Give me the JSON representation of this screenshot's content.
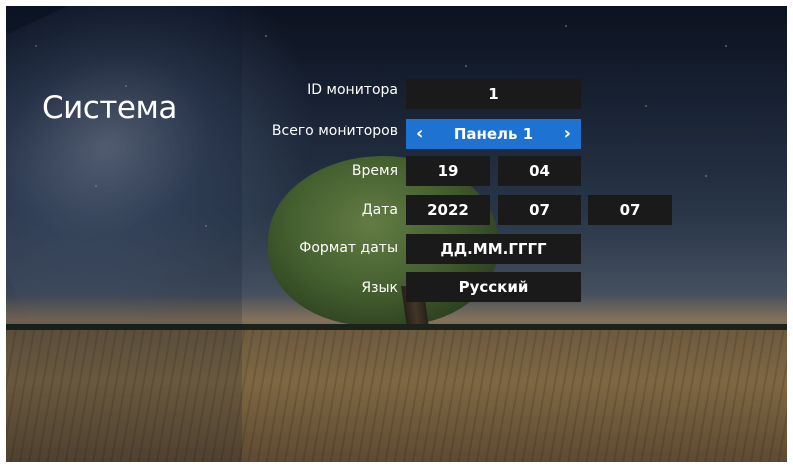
{
  "screen": {
    "title": "Система"
  },
  "settings": {
    "monitor_id": {
      "label": "ID монитора",
      "value": "1"
    },
    "total_monitors": {
      "label": "Всего мониторов",
      "value": "Панель 1"
    },
    "time": {
      "label": "Время",
      "hours": "19",
      "minutes": "04"
    },
    "date": {
      "label": "Дата",
      "year": "2022",
      "month": "07",
      "day": "07"
    },
    "date_format": {
      "label": "Формат даты",
      "value": "ДД.ММ.ГГГГ"
    },
    "language": {
      "label": "Язык",
      "value": "Русский"
    }
  },
  "icons": {
    "prev": "chevron-left-icon",
    "next": "chevron-right-icon"
  },
  "colors": {
    "accent": "#1e73d2",
    "field_bg": "#1a1a1a",
    "text": "#ffffff"
  }
}
